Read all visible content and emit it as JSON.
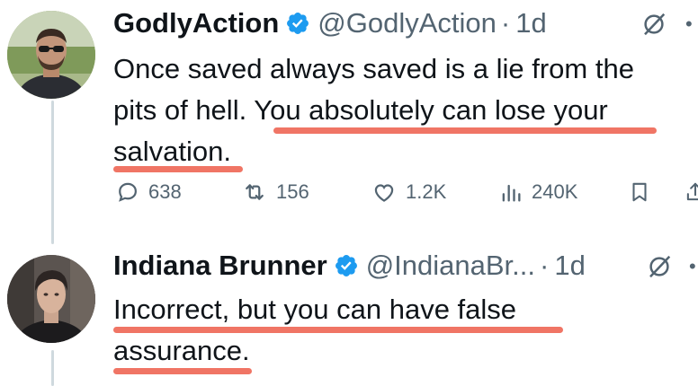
{
  "tweets": [
    {
      "display_name": "GodlyAction",
      "handle": "@GodlyAction",
      "separator": "·",
      "time": "1d",
      "verified": true,
      "line1": "Once saved always saved is a lie from the",
      "line2_plain": "pits of hell. ",
      "line2_marked": "You absolutely can lose your",
      "line3_marked": "salvation.",
      "actions": {
        "replies": "638",
        "reposts": "156",
        "likes": "1.2K",
        "views": "240K"
      }
    },
    {
      "display_name": "Indiana Brunner",
      "handle": "@IndianaBr...",
      "separator": "·",
      "time": "1d",
      "verified": true,
      "line1_marked": "Incorrect, but you can have false",
      "line2_marked": "assurance."
    }
  ],
  "colors": {
    "verified_badge": "#1d9bf0",
    "highlight_underline": "#f07565",
    "muted_text": "#536471"
  },
  "icons": [
    "verified-badge-icon",
    "grok-icon",
    "more-icon",
    "reply-icon",
    "repost-icon",
    "like-icon",
    "views-icon",
    "bookmark-icon",
    "share-icon"
  ]
}
